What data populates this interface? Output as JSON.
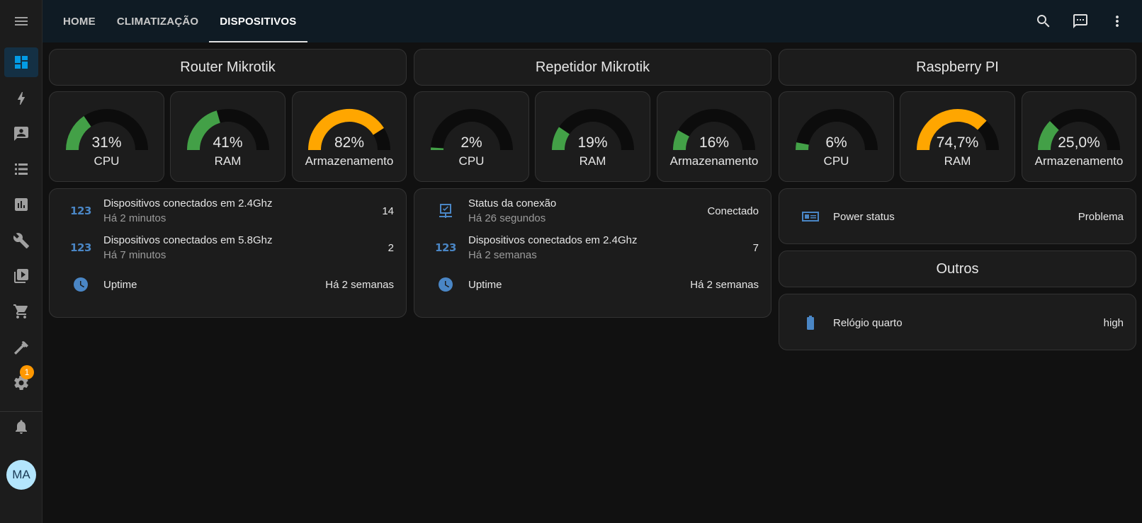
{
  "header": {
    "tabs": [
      {
        "label": "HOME"
      },
      {
        "label": "CLIMATIZAÇÃO"
      },
      {
        "label": "DISPOSITIVOS",
        "active": true
      }
    ],
    "actions": [
      "search-icon",
      "assist-icon",
      "more-vert-icon"
    ]
  },
  "sidebar": {
    "items": [
      {
        "icon": "dashboard-icon",
        "active": true
      },
      {
        "icon": "energy-icon"
      },
      {
        "icon": "person-card-icon"
      },
      {
        "icon": "logbook-icon"
      },
      {
        "icon": "history-icon"
      },
      {
        "icon": "developer-tools-icon"
      },
      {
        "icon": "media-icon"
      },
      {
        "icon": "shopping-cart-icon"
      },
      {
        "icon": "hammer-icon"
      },
      {
        "icon": "settings-icon"
      }
    ],
    "settings_badge": "1",
    "notifications_icon": "bell-icon",
    "avatar_initials": "MA"
  },
  "colors": {
    "accent": "#039be5",
    "gauge_green": "#43a047",
    "gauge_orange": "#ffa600",
    "gauge_track": "#0c0c0c",
    "icon_blue": "#4a86c5"
  },
  "columns": [
    {
      "title": "Router Mikrotik",
      "gauges": [
        {
          "value_text": "31%",
          "value": 31,
          "label": "CPU",
          "color": "#43a047"
        },
        {
          "value_text": "41%",
          "value": 41,
          "label": "RAM",
          "color": "#43a047"
        },
        {
          "value_text": "82%",
          "value": 82,
          "label": "Armazenamento",
          "color": "#ffa600"
        }
      ],
      "entities": [
        {
          "icon": "numeric-icon",
          "name": "Dispositivos conectados em 2.4Ghz",
          "secondary": "Há 2 minutos",
          "value": "14"
        },
        {
          "icon": "numeric-icon",
          "name": "Dispositivos conectados em 5.8Ghz",
          "secondary": "Há 7 minutos",
          "value": "2"
        },
        {
          "icon": "clock-icon",
          "name": "Uptime",
          "secondary": "",
          "value": "Há 2 semanas"
        }
      ]
    },
    {
      "title": "Repetidor Mikrotik",
      "gauges": [
        {
          "value_text": "2%",
          "value": 2,
          "label": "CPU",
          "color": "#43a047"
        },
        {
          "value_text": "19%",
          "value": 19,
          "label": "RAM",
          "color": "#43a047"
        },
        {
          "value_text": "16%",
          "value": 16,
          "label": "Armazenamento",
          "color": "#43a047"
        }
      ],
      "entities": [
        {
          "icon": "network-check-icon",
          "name": "Status da conexão",
          "secondary": "Há 26 segundos",
          "value": "Conectado"
        },
        {
          "icon": "numeric-icon",
          "name": "Dispositivos conectados em 2.4Ghz",
          "secondary": "Há 2 semanas",
          "value": "7"
        },
        {
          "icon": "clock-icon",
          "name": "Uptime",
          "secondary": "",
          "value": "Há 2 semanas"
        }
      ]
    },
    {
      "title": "Raspberry PI",
      "gauges": [
        {
          "value_text": "6%",
          "value": 6,
          "label": "CPU",
          "color": "#43a047"
        },
        {
          "value_text": "74,7%",
          "value": 74.7,
          "label": "RAM",
          "color": "#ffa600"
        },
        {
          "value_text": "25,0%",
          "value": 25,
          "label": "Armazenamento",
          "color": "#43a047"
        }
      ],
      "power": {
        "icon": "power-supply-icon",
        "name": "Power status",
        "value": "Problema"
      },
      "others_title": "Outros",
      "others": {
        "icon": "battery-icon",
        "name": "Relógio quarto",
        "value": "high"
      }
    }
  ]
}
